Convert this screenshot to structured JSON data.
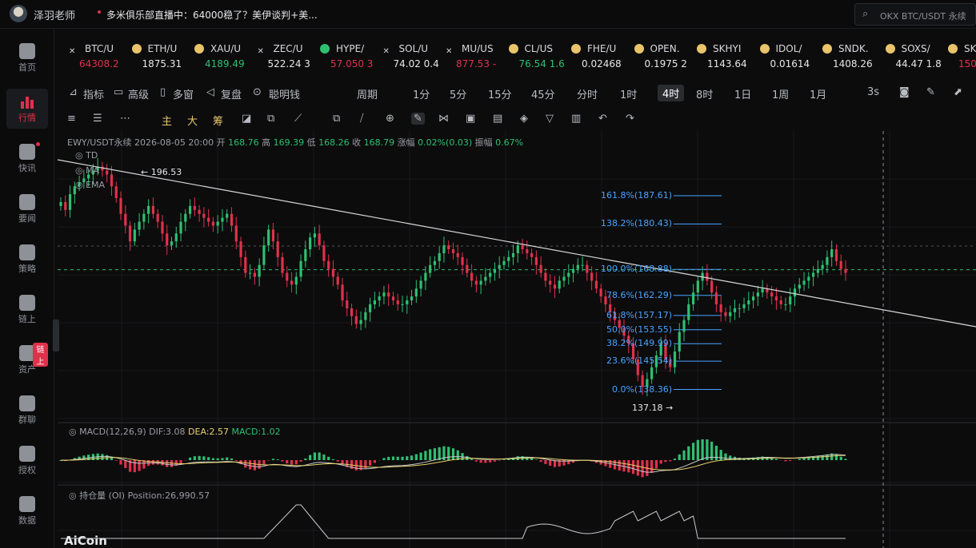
{
  "header": {
    "username": "泽羽老师",
    "news": "多米俱乐部直播中：64000稳了？美伊谈判+美...",
    "search_placeholder": "OKX BTC/USDT 永续"
  },
  "sidebar": {
    "items": [
      {
        "label": "首页"
      },
      {
        "label": "行情"
      },
      {
        "label": "快讯"
      },
      {
        "label": "要闻"
      },
      {
        "label": "策略"
      },
      {
        "label": "链上"
      },
      {
        "label": "资产",
        "badge": "链上"
      },
      {
        "label": "群聊"
      },
      {
        "label": "授权"
      },
      {
        "label": "数据"
      }
    ]
  },
  "tickers": [
    {
      "name": "BTC/U",
      "price": "64308.2",
      "dir": "dn"
    },
    {
      "name": "ETH/U",
      "price": "1875.31",
      "dir": "wt"
    },
    {
      "name": "XAU/U",
      "price": "4189.49",
      "dir": "up"
    },
    {
      "name": "ZEC/U",
      "price": "522.24 3",
      "dir": "wt"
    },
    {
      "name": "HYPE/",
      "price": "57.050 3",
      "dir": "dn"
    },
    {
      "name": "SOL/U",
      "price": "74.02 0.4",
      "dir": "wt"
    },
    {
      "name": "MU/US",
      "price": "877.53 -",
      "dir": "dn"
    },
    {
      "name": "CL/US",
      "price": "76.54 1.6",
      "dir": "up"
    },
    {
      "name": "FHE/U",
      "price": "0.02468",
      "dir": "wt"
    },
    {
      "name": "OPEN.",
      "price": "0.1975 2",
      "dir": "wt"
    },
    {
      "name": "SKHYI",
      "price": "1143.64",
      "dir": "wt"
    },
    {
      "name": "IDOL/",
      "price": "0.01614",
      "dir": "wt"
    },
    {
      "name": "SNDK.",
      "price": "1408.26",
      "dir": "wt"
    },
    {
      "name": "SOXS/",
      "price": "44.47 1.8",
      "dir": "wt"
    },
    {
      "name": "SK",
      "price": "150.3",
      "dir": "dn"
    }
  ],
  "toolbar": {
    "items": [
      "指标",
      "高级",
      "多窗",
      "复盘",
      "聪明钱",
      "周期",
      "1分",
      "5分",
      "15分",
      "45分",
      "分时",
      "1时",
      "4时",
      "8时",
      "1日",
      "1周",
      "1月",
      "3s"
    ],
    "selected": "4时"
  },
  "drawbar": {
    "items": [
      "主",
      "大",
      "筹"
    ]
  },
  "chart": {
    "symbol_line": "EWY/USDT永续  2026-08-05 20:00",
    "open_label": "开",
    "open": "168.76",
    "high_label": "高",
    "high": "169.39",
    "low_label": "低",
    "low": "168.26",
    "close_label": "收",
    "close": "168.79",
    "change_label": "涨幅",
    "change": "0.02%(0.03)",
    "amp_label": "振幅",
    "amp": "0.67%",
    "indicators": [
      "TD",
      "MA",
      "EMA"
    ],
    "high_marker": "← 196.53",
    "low_marker": "137.18 →",
    "fib_levels": [
      "161.8%(187.61)",
      "138.2%(180.43)",
      "100.0%(168.88)",
      "78.6%(162.29)",
      "61.8%(157.17)",
      "50.0%(153.55)",
      "38.2%(149.99)",
      "23.6%(145.54)",
      "0.0%(138.36)"
    ],
    "macd_title": "MACD(12,26,9)",
    "macd_dif": "DIF:3.08",
    "macd_dea": "DEA:2.57",
    "macd_val": "MACD:1.02",
    "oi_title": "持仓量 (OI)",
    "oi_value": "Position:26,990.57",
    "logo": "AiCoin"
  },
  "chart_data": {
    "type": "candlestick",
    "title": "EWY/USDT永续",
    "last_bar": {
      "open": 168.76,
      "high": 169.39,
      "low": 168.26,
      "close": 168.79
    },
    "range_high": 196.53,
    "range_low": 137.18,
    "fibonacci": [
      {
        "level": "161.8%",
        "price": 187.61
      },
      {
        "level": "138.2%",
        "price": 180.43
      },
      {
        "level": "100.0%",
        "price": 168.88
      },
      {
        "level": "78.6%",
        "price": 162.29
      },
      {
        "level": "61.8%",
        "price": 157.17
      },
      {
        "level": "50.0%",
        "price": 153.55
      },
      {
        "level": "38.2%",
        "price": 149.99
      },
      {
        "level": "23.6%",
        "price": 145.54
      },
      {
        "level": "0.0%",
        "price": 138.36
      }
    ],
    "closes": [
      186,
      184,
      188,
      190,
      191,
      192,
      193,
      194,
      195,
      194,
      193,
      190,
      187,
      183,
      180,
      176,
      179,
      181,
      183,
      185,
      183,
      181,
      178,
      175,
      176,
      178,
      181,
      183,
      185,
      184,
      183,
      182,
      181,
      180,
      181,
      182,
      183,
      180,
      176,
      172,
      168,
      168,
      167,
      170,
      175,
      179,
      176,
      172,
      168,
      166,
      165,
      167,
      171,
      174,
      177,
      178,
      175,
      171,
      169,
      167,
      165,
      161,
      159,
      157,
      155,
      156,
      158,
      160,
      161,
      162,
      163,
      162,
      161,
      160,
      160,
      161,
      162,
      164,
      166,
      168,
      170,
      171,
      173,
      175,
      174,
      173,
      172,
      170,
      168,
      166,
      165,
      166,
      167,
      168,
      169,
      170,
      171,
      172,
      173,
      175,
      174,
      173,
      172,
      170,
      168,
      166,
      165,
      164,
      166,
      167,
      168,
      169,
      170,
      170,
      168,
      166,
      164,
      162,
      160,
      158,
      156,
      154,
      152,
      150,
      146,
      142,
      139,
      141,
      144,
      147,
      150,
      146,
      144,
      148,
      153,
      156,
      160,
      163,
      166,
      168,
      166,
      163,
      160,
      158,
      157,
      158,
      159,
      159,
      160,
      161,
      162,
      163,
      164,
      163,
      162,
      161,
      160,
      160,
      162,
      164,
      165,
      166,
      167,
      168,
      169,
      170,
      172,
      174,
      171,
      169,
      168
    ]
  }
}
